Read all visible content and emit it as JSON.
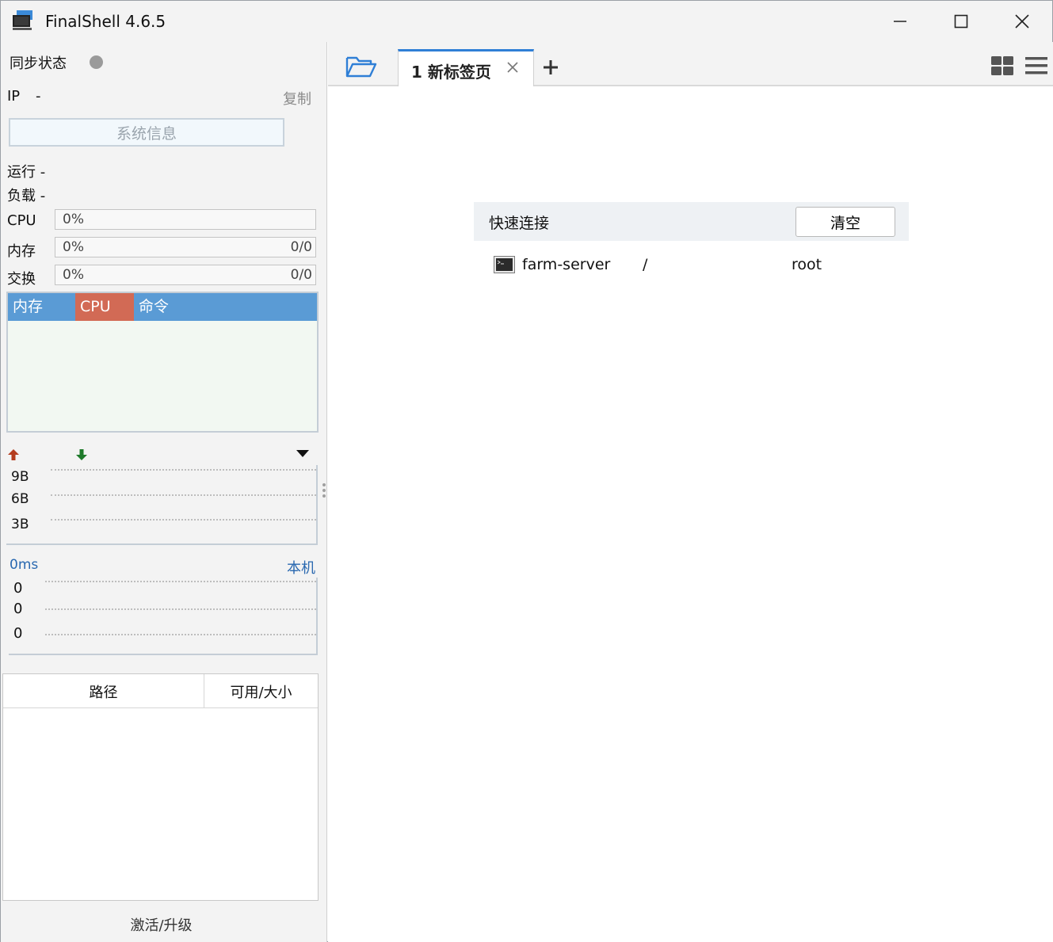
{
  "window": {
    "title": "FinalShell 4.6.5"
  },
  "status": {
    "sync_label": "同步状态",
    "ip_label": "IP",
    "ip_value": "-",
    "copy_label": "复制",
    "sysinfo_label": "系统信息",
    "uptime_label": "运行 -",
    "load_label": "负载 -",
    "cpu": {
      "label": "CPU",
      "percent": "0%"
    },
    "memory": {
      "label": "内存",
      "percent": "0%",
      "value": "0/0"
    },
    "swap": {
      "label": "交换",
      "percent": "0%",
      "value": "0/0"
    },
    "sync_color": "#9a9a9a"
  },
  "process_tabs": {
    "memory": "内存",
    "cpu": "CPU",
    "command": "命令"
  },
  "network": {
    "ticks": [
      "9B",
      "6B",
      "3B"
    ],
    "up_color": "#b43c1e",
    "down_color": "#1e7a2a"
  },
  "ping": {
    "latency": "0ms",
    "host_label": "本机",
    "ticks": [
      "0",
      "0",
      "0"
    ]
  },
  "disk_table": {
    "columns": [
      "路径",
      "可用/大小"
    ]
  },
  "footer": {
    "activate_label": "激活/升级"
  },
  "tabs": [
    {
      "label": "1 新标签页",
      "active": true
    }
  ],
  "quick_connect": {
    "title": "快速连接",
    "clear_label": "清空",
    "connections": [
      {
        "name": "farm-server",
        "path": "/",
        "user": "root"
      }
    ]
  },
  "colors": {
    "accent": "#2f7fd6",
    "proc_header": "#5a9bd5",
    "proc_cpu": "#d26a55",
    "link": "#2968b0"
  }
}
